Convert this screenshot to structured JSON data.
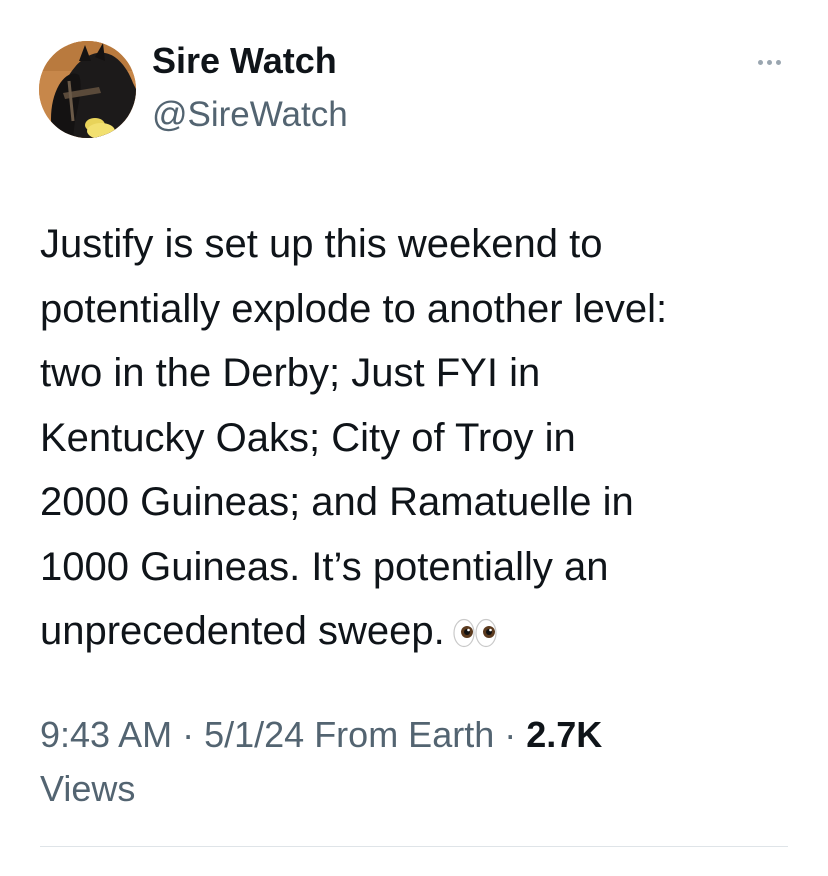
{
  "author": {
    "name": "Sire Watch",
    "handle": "@SireWatch"
  },
  "tweet": {
    "lines": [
      "Justify is set up this weekend to",
      "potentially explode to another level:",
      "two in the Derby; Just FYI in",
      "Kentucky Oaks; City of Troy in",
      "2000 Guineas; and Ramatuelle in",
      "1000 Guineas. It’s potentially an",
      "unprecedented sweep."
    ],
    "emoji": "eyes-emoji"
  },
  "meta": {
    "time": "9:43 AM",
    "separator1": " · ",
    "date": "5/1/24",
    "source": " From Earth",
    "separator2": " · ",
    "views_count": "2.7K",
    "views_label": "Views"
  },
  "icons": {
    "more": "more-horizontal-icon",
    "avatar": "horse-avatar"
  },
  "colors": {
    "text_primary": "#0f1419",
    "text_secondary": "#536471",
    "divider": "#dfe4e8"
  }
}
